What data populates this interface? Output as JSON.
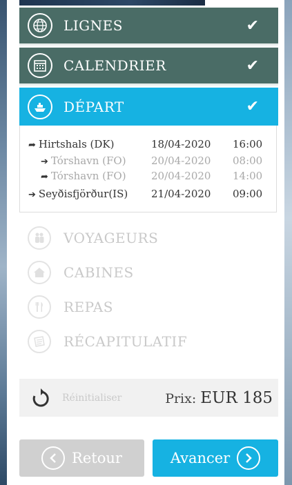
{
  "steps_done": [
    {
      "label": "LIGNES",
      "icon": "globe-icon"
    },
    {
      "label": "CALENDRIER",
      "icon": "calendar-icon"
    }
  ],
  "step_active": {
    "label": "DÉPART",
    "icon": "ship-icon"
  },
  "check_icon": "check-icon",
  "trip": {
    "rows": [
      {
        "port": "Hirtshals (DK)",
        "date": "18/04-2020",
        "time": "16:00",
        "kind": "departure"
      },
      {
        "port": "Tórshavn (FO)",
        "date": "20/04-2020",
        "time": "08:00",
        "kind": "arrival-stop"
      },
      {
        "port": "Tórshavn (FO)",
        "date": "20/04-2020",
        "time": "14:00",
        "kind": "departure-stop"
      },
      {
        "port": "Seyðisfjörður(IS)",
        "date": "21/04-2020",
        "time": "09:00",
        "kind": "arrival"
      }
    ]
  },
  "steps_future": [
    {
      "label": "VOYAGEURS",
      "icon": "passengers-icon"
    },
    {
      "label": "CABINES",
      "icon": "home-icon"
    },
    {
      "label": "REPAS",
      "icon": "cutlery-icon"
    },
    {
      "label": "RÉCAPITULATIF",
      "icon": "document-icon"
    }
  ],
  "reset_label": "Réinitialiser",
  "price": {
    "label": "Prix:",
    "amount": "EUR 185"
  },
  "buttons": {
    "back": "Retour",
    "next": "Avancer"
  },
  "colors": {
    "done": "#4a6c66",
    "active": "#16b2e2",
    "disabled": "#d0d0d0"
  }
}
